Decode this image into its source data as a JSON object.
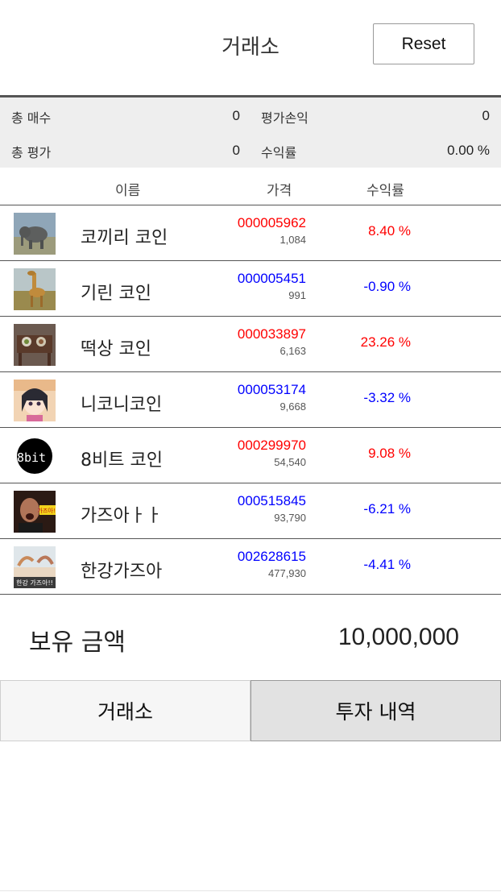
{
  "header": {
    "title": "거래소",
    "reset_label": "Reset"
  },
  "summary": {
    "total_buy_label": "총 매수",
    "total_buy_value": "0",
    "eval_pl_label": "평가손익",
    "eval_pl_value": "0",
    "total_eval_label": "총 평가",
    "total_eval_value": "0",
    "return_label": "수익률",
    "return_value": "0.00 %"
  },
  "columns": {
    "name": "이름",
    "price": "가격",
    "return": "수익률"
  },
  "colors": {
    "up": "#ff0000",
    "down": "#0000ff"
  },
  "coins": [
    {
      "name": "코끼리 코인",
      "price": "000005962",
      "sub": "1,084",
      "rate": "8.40 %",
      "trend": "up",
      "icon": "elephant-image"
    },
    {
      "name": "기린 코인",
      "price": "000005451",
      "sub": "991",
      "rate": "-0.90 %",
      "trend": "down",
      "icon": "giraffe-image"
    },
    {
      "name": "떡상 코인",
      "price": "000033897",
      "sub": "6,163",
      "rate": "23.26 %",
      "trend": "up",
      "icon": "table-food-image"
    },
    {
      "name": "니코니코인",
      "price": "000053174",
      "sub": "9,668",
      "rate": "-3.32 %",
      "trend": "down",
      "icon": "anime-girl-image"
    },
    {
      "name": "8비트 코인",
      "price": "000299970",
      "sub": "54,540",
      "rate": "9.08 %",
      "trend": "up",
      "icon": "8bit-logo",
      "icon_text": "8bit"
    },
    {
      "name": "가즈아ㅏㅏ",
      "price": "000515845",
      "sub": "93,790",
      "rate": "-6.21 %",
      "trend": "down",
      "icon": "shouting-man-image",
      "icon_text": "가즈아!!"
    },
    {
      "name": "한강가즈아",
      "price": "002628615",
      "sub": "477,930",
      "rate": "-4.41 %",
      "trend": "down",
      "icon": "han-river-jump-image",
      "icon_text": "한강 가즈아!!"
    }
  ],
  "holding": {
    "label": "보유 금액",
    "value": "10,000,000"
  },
  "tabs": {
    "exchange": "거래소",
    "history": "투자 내역"
  }
}
